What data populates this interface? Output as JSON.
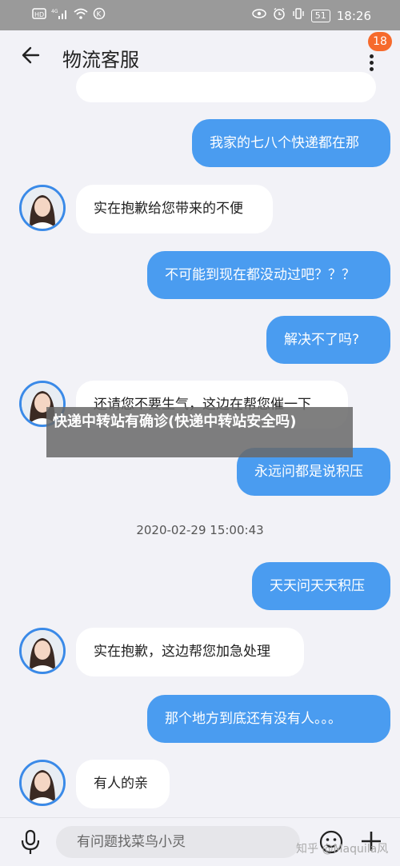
{
  "status_bar": {
    "left_icons": [
      "sim-hd-icon",
      "signal-4g-icon",
      "wifi-icon",
      "data-icon"
    ],
    "right_icons": [
      "eye-icon",
      "alarm-icon",
      "vibrate-icon"
    ],
    "battery": "51",
    "time": "18:26"
  },
  "header": {
    "title": "物流客服",
    "badge_count": "18"
  },
  "messages": [
    {
      "from": "user",
      "text": "我家的七八个快递都在那"
    },
    {
      "from": "agent",
      "text": "实在抱歉给您带来的不便"
    },
    {
      "from": "user",
      "text": "不可能到现在都没动过吧？？？"
    },
    {
      "from": "user",
      "text": "解决不了吗?"
    },
    {
      "from": "agent",
      "text": "还请您不要生气，这边在帮您催一下"
    },
    {
      "from": "user",
      "text": "永远问都是说积压"
    },
    {
      "from": "user",
      "text": "天天问天天积压"
    },
    {
      "from": "agent",
      "text": "实在抱歉，这边帮您加急处理"
    },
    {
      "from": "user",
      "text": "那个地方到底还有没有人。。。"
    },
    {
      "from": "agent",
      "text": "有人的亲"
    }
  ],
  "timestamp": "2020-02-29 15:00:43",
  "overlay_caption": "快递中转站有确诊(快递中转站安全吗)",
  "input": {
    "placeholder": "有问题找菜鸟小灵"
  },
  "watermark": "知乎 @Maquila风",
  "colors": {
    "accent": "#4a9cf0",
    "badge": "#f66a2c",
    "background": "#f2f2f7"
  }
}
